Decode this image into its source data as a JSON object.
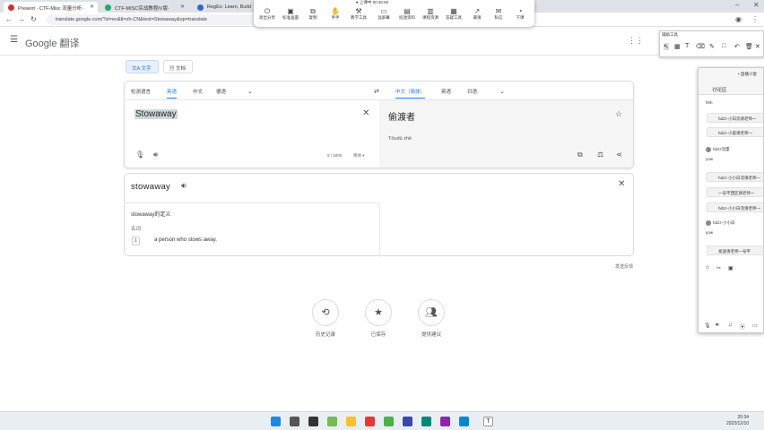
{
  "browser": {
    "tabs": [
      {
        "label": "Present · CTF-Misc 流量分析 ·"
      },
      {
        "label": "CTF-MISC实战教程IV版·"
      },
      {
        "label": "RegEx: Learn, Build"
      }
    ],
    "url": "translate.google.com/?sl=en&tl=zh-CN&text=Stowaway&op=translate"
  },
  "recorder": {
    "status": "● 上课中 00:40:50",
    "buttons": [
      "退出分享",
      "标准画面",
      "复制",
      "手手",
      "教学工具",
      "远屏幕",
      "投放资料",
      "课程资源",
      "答疑工具",
      "邀请",
      "私信",
      "下课"
    ]
  },
  "google": {
    "logo": "Google 翻译",
    "modes": {
      "text": "文字",
      "docs": "文档"
    }
  },
  "source_langs": [
    "检测语言",
    "英语",
    "中文",
    "德语"
  ],
  "target_langs": [
    "中文（简体）",
    "英语",
    "日语"
  ],
  "source": {
    "text": "Stowaway",
    "count": "8 / 5000",
    "ime": "简体"
  },
  "target": {
    "text": "偷渡者",
    "romanization": "Tōudù zhě"
  },
  "dictionary": {
    "word": "stowaway",
    "definition_title": "stowaway的定义",
    "pos": "名词",
    "number": "1",
    "definition": "a person who stows away."
  },
  "feedback": "发送反馈",
  "bottom_actions": [
    {
      "label": "历史记录"
    },
    {
      "label": "已保存"
    },
    {
      "label": "提供建议"
    }
  ],
  "chat": {
    "tool_title": "辅助工具",
    "title": "• 直播小窗",
    "tab": "讨论区",
    "messages": [
      {
        "kind": "text",
        "text": "hhh"
      },
      {
        "kind": "bubble",
        "text": "hdzz-小白流请老师一"
      },
      {
        "kind": "bubble",
        "text": "hdzz-小渠请老师一"
      },
      {
        "kind": "user",
        "text": "hdzz流量"
      },
      {
        "kind": "text",
        "text": "yow"
      },
      {
        "kind": "bubble",
        "text": "hdzz-小小白流请老师一"
      },
      {
        "kind": "bubble",
        "text": "一号平西区请老师一"
      },
      {
        "kind": "bubble",
        "text": "hdzz-小小白流请老师一"
      },
      {
        "kind": "user",
        "text": "hdzz-小小白"
      },
      {
        "kind": "text",
        "text": "yow"
      },
      {
        "kind": "bubble",
        "text": "发送请老师一号平"
      }
    ]
  },
  "clock": {
    "time": "20:34",
    "date": "2022/12/10"
  }
}
